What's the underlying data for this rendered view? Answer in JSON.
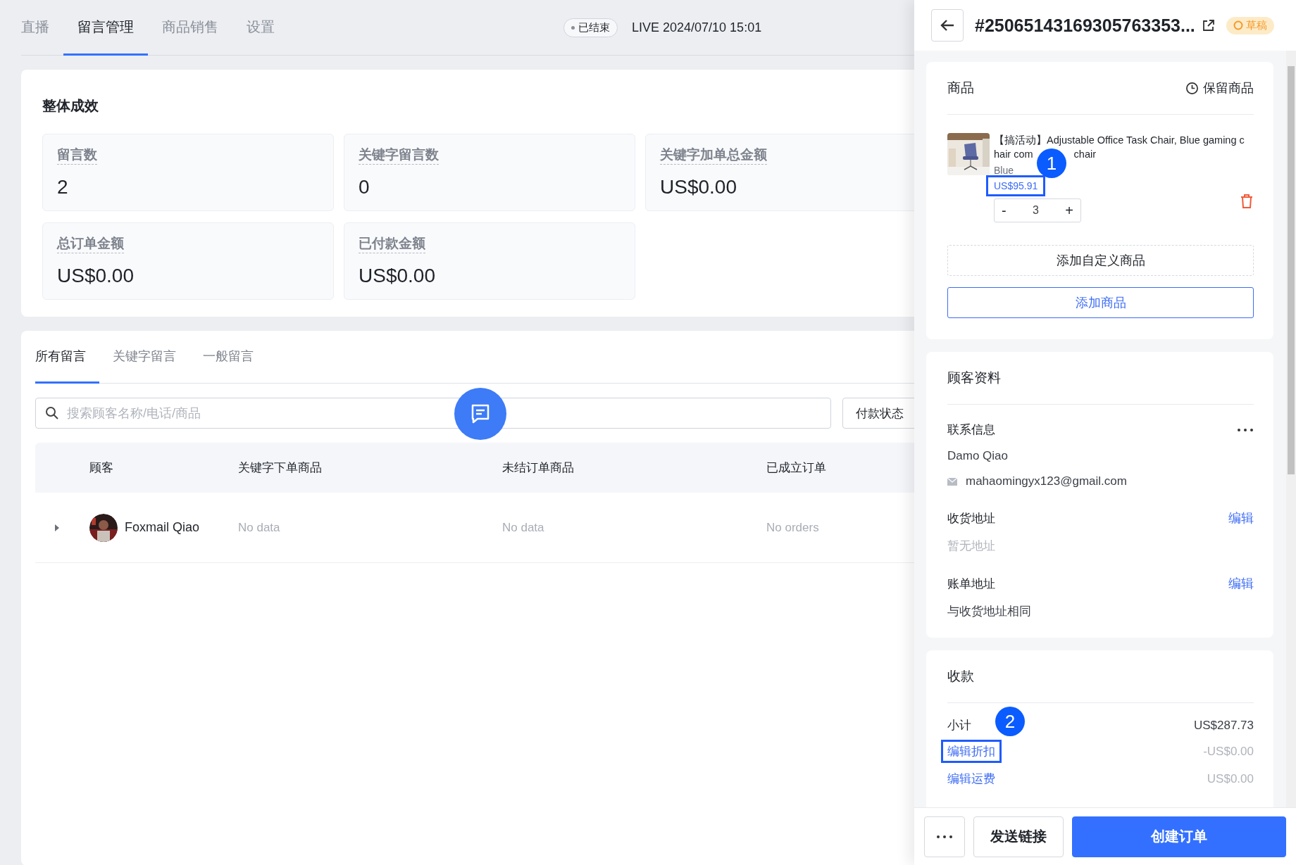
{
  "nav_tabs": [
    {
      "label": "直播",
      "selected": false
    },
    {
      "label": "留言管理",
      "selected": true
    },
    {
      "label": "商品销售",
      "selected": false
    },
    {
      "label": "设置",
      "selected": false
    }
  ],
  "live_status": {
    "badge": "已结束",
    "time": "LIVE 2024/07/10 15:01"
  },
  "overview": {
    "title": "整体成效",
    "stats": [
      {
        "label": "留言数",
        "value": "2"
      },
      {
        "label": "关键字留言数",
        "value": "0"
      },
      {
        "label": "关键字加单总金额",
        "value": "US$0.00"
      },
      {
        "label": "总订单金额",
        "value": "US$0.00"
      },
      {
        "label": "已付款金额",
        "value": "US$0.00"
      }
    ]
  },
  "comments": {
    "tabs": [
      {
        "label": "所有留言",
        "selected": true
      },
      {
        "label": "关键字留言",
        "selected": false
      },
      {
        "label": "一般留言",
        "selected": false
      }
    ],
    "search": {
      "placeholder": "搜索顾客名称/电话/商品"
    },
    "filter": "付款状态",
    "columns": [
      "顾客",
      "关键字下单商品",
      "未结订单商品",
      "已成立订单"
    ],
    "rows": [
      {
        "customer": "Foxmail Qiao",
        "keyword_products": "No data",
        "open_products": "No data",
        "orders": "No orders",
        "expanded": false
      }
    ]
  },
  "drawer": {
    "title": "#25065143169305763353...",
    "status": "草稿",
    "products": {
      "title": "商品",
      "action": "保留商品",
      "items": [
        {
          "name": "【搞活动】Adjustable Office Task Chair, Blue gaming chair com",
          "name_tail": "chair",
          "variant": "Blue",
          "price": "US$95.91",
          "price_marker": "1",
          "quantity": "3",
          "minus": "-",
          "plus": "+"
        }
      ],
      "add_custom": "添加自定义商品",
      "add": "添加商品"
    },
    "customer": {
      "title": "顾客资料",
      "contact_label": "联系信息",
      "name": "Damo Qiao",
      "email": "mahaomingyx123@gmail.com",
      "addresses": [
        {
          "label": "收货地址",
          "edit": "编辑",
          "value": "暂无地址",
          "empty": true
        },
        {
          "label": "账单地址",
          "edit": "编辑",
          "value": "与收货地址相同",
          "empty": false
        }
      ]
    },
    "payment": {
      "title": "收款",
      "lines": [
        {
          "kind": "text",
          "label": "小计",
          "value": "US$287.73",
          "muted": false
        },
        {
          "kind": "link",
          "label": "编辑折扣",
          "value": "-US$0.00",
          "muted": true,
          "marker": "2"
        },
        {
          "kind": "link",
          "label": "编辑运费",
          "value": "US$0.00",
          "muted": true
        }
      ]
    },
    "footer": {
      "send": "发送链接",
      "create": "创建订单"
    }
  }
}
